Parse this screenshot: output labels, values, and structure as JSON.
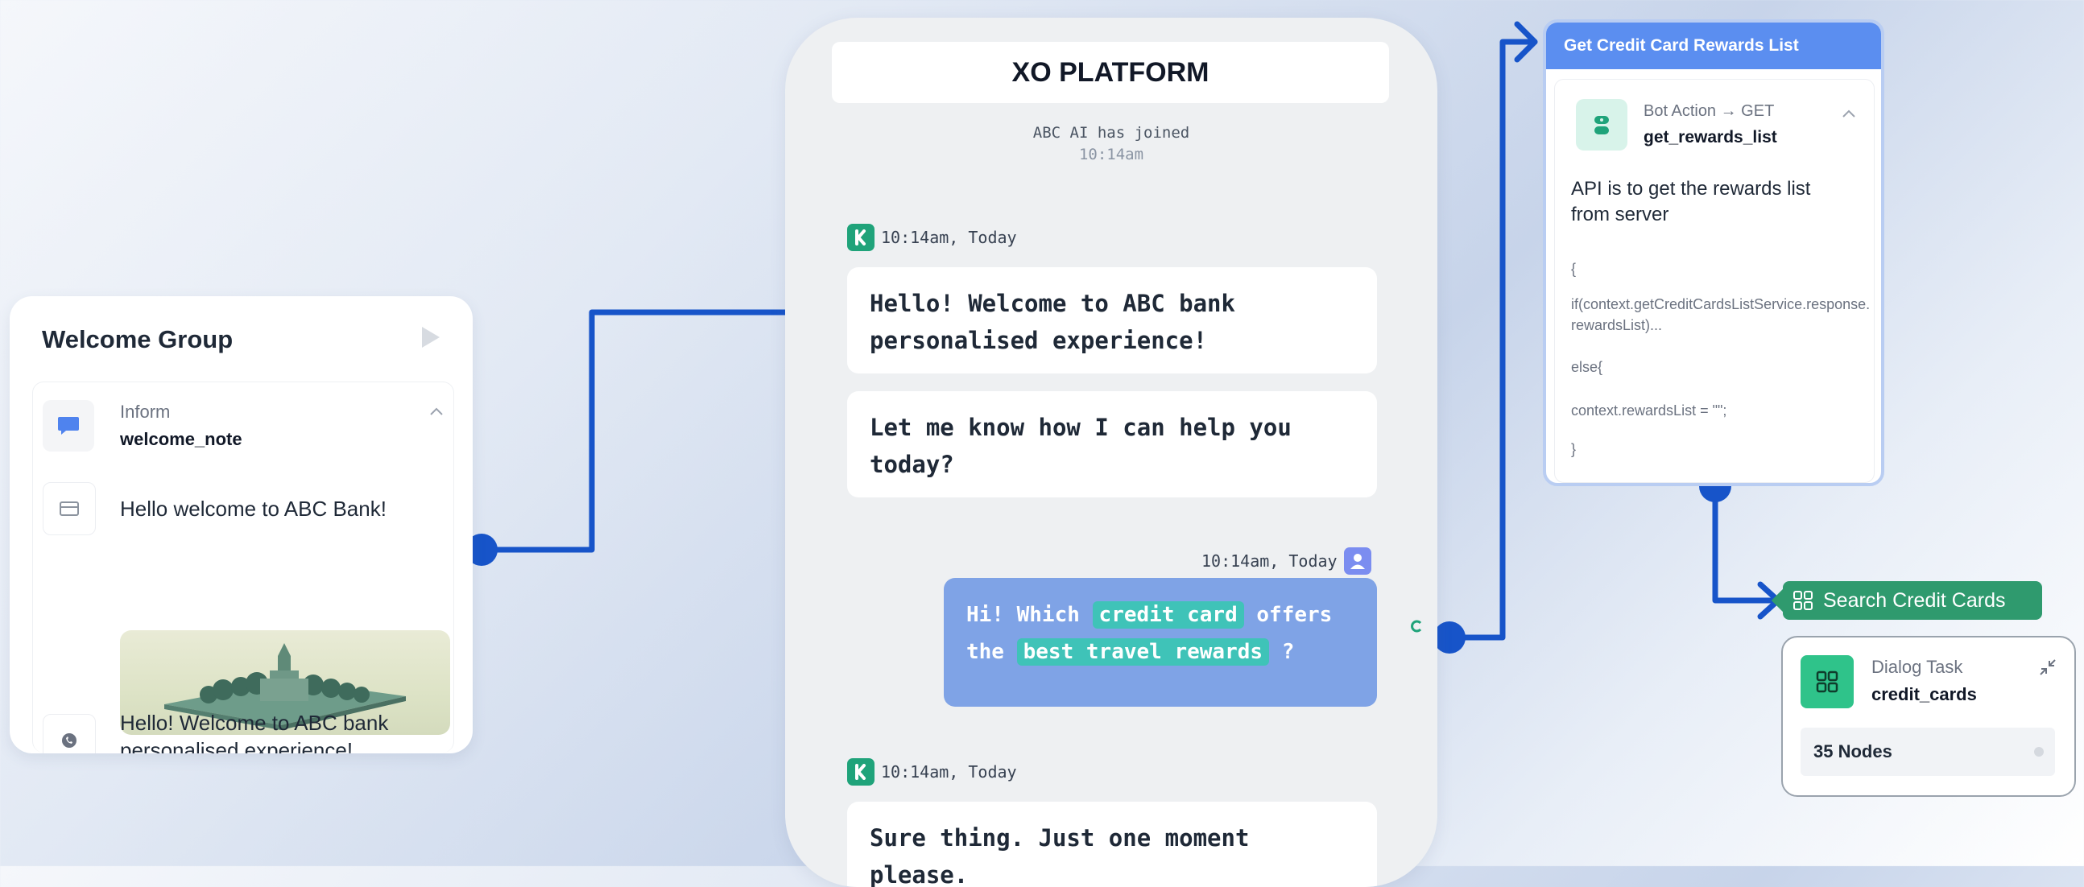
{
  "welcome_group": {
    "title": "Welcome Group",
    "inform_label": "Inform",
    "inform_name": "welcome_note",
    "message_text": "Hello welcome to ABC Bank!",
    "whatsapp_text": "Hello! Welcome to ABC bank personalised experience!"
  },
  "chat": {
    "platform_title": "XO PLATFORM",
    "joined_text": "ABC AI has joined",
    "joined_time": "10:14am",
    "bot_timestamp_1": "10:14am, Today",
    "bot_message_1": "Hello! Welcome to ABC bank personalised experience!",
    "bot_message_2": "Let me know how I can help you today?",
    "user_timestamp": "10:14am, Today",
    "user_message": {
      "part1": "Hi! Which",
      "highlight1": "credit card",
      "part2": "offers the",
      "highlight2": "best travel rewards",
      "part3": "?"
    },
    "bot_timestamp_2": "10:14am, Today",
    "bot_message_3": "Sure thing. Just one moment please."
  },
  "rewards_card": {
    "header": "Get Credit Card Rewards List",
    "action_label": "Bot Action → GET",
    "action_name": "get_rewards_list",
    "description": "API is to get the rewards list from server",
    "code_open": "{",
    "code_if": "if(context.getCreditCardsListService.response.rewardsList)...",
    "code_else": "else{",
    "code_assign": "context.rewardsList = \"\";",
    "code_close": "}"
  },
  "search_pill": {
    "label": "Search Credit Cards"
  },
  "dialog_task": {
    "label": "Dialog Task",
    "name": "credit_cards",
    "nodes": "35 Nodes"
  },
  "colors": {
    "connector": "#1754c9",
    "rewards_header": "#5b8ef0",
    "pill_green": "#2f9a6e",
    "user_bubble": "#7fa3e6",
    "highlight": "#3fc3b8"
  }
}
